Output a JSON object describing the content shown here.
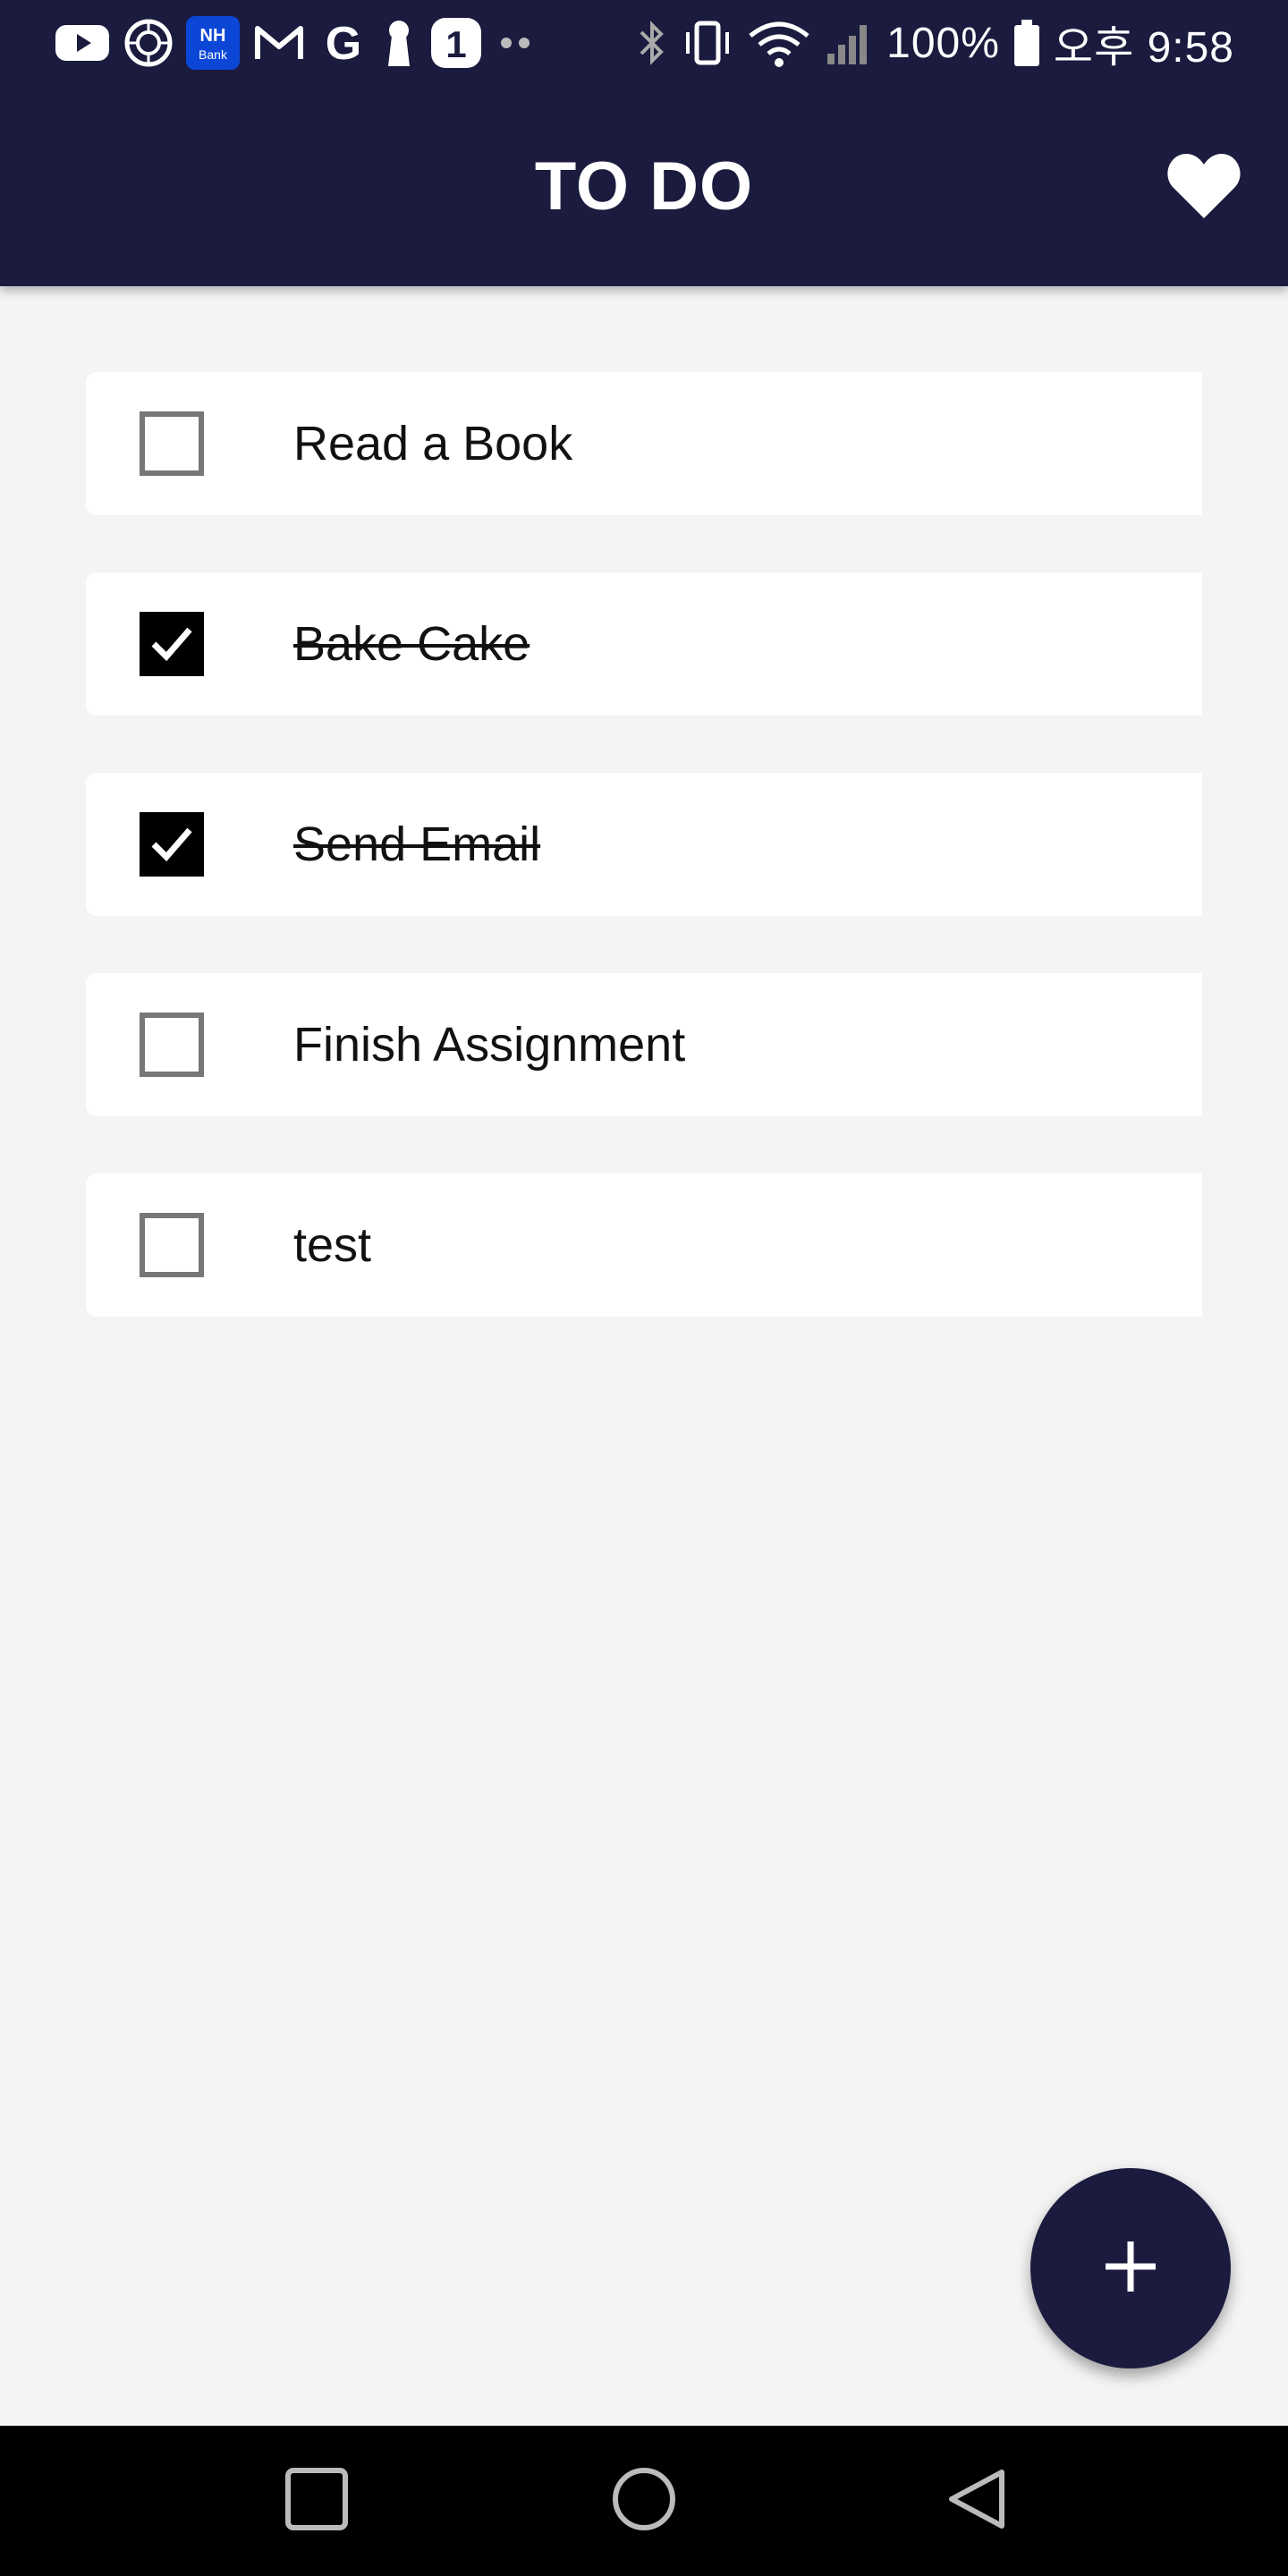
{
  "status_bar": {
    "battery": "100%",
    "time": "오후 9:58",
    "notification_icons": [
      "youtube-icon",
      "camera-lens-icon",
      "nh-bank-icon",
      "gmail-icon",
      "google-icon",
      "keyhole-icon",
      "one-app-icon",
      "more-dots-icon"
    ],
    "nh_bank_label_top": "NH",
    "nh_bank_label_bottom": "Bank",
    "one_app_label": "1",
    "g_label": "G"
  },
  "app_bar": {
    "title": "TO DO",
    "favorite_icon": "heart-icon"
  },
  "todos": [
    {
      "label": "Read a Book",
      "checked": false
    },
    {
      "label": "Bake Cake",
      "checked": true
    },
    {
      "label": "Send Email",
      "checked": true
    },
    {
      "label": "Finish Assignment",
      "checked": false
    },
    {
      "label": "test",
      "checked": false
    }
  ],
  "fab": {
    "icon": "plus-icon"
  },
  "nav_bar": {
    "buttons": [
      "recents-square-icon",
      "home-circle-icon",
      "back-triangle-icon"
    ]
  },
  "colors": {
    "primary": "#1b1b3f",
    "background": "#f4f4f4",
    "card": "#ffffff",
    "checked": "#000000",
    "unchecked_border": "#777777"
  }
}
